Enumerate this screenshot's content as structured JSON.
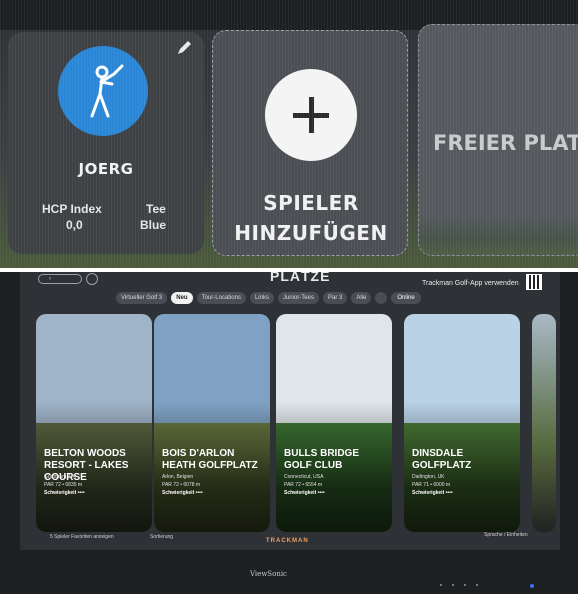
{
  "player_select": {
    "player": {
      "name": "JOERG",
      "hcp_label": "HCP Index",
      "hcp_value": "0,0",
      "tee_label": "Tee",
      "tee_value": "Blue",
      "avatar_icon": "golfer-icon",
      "avatar_color": "#2a86d6"
    },
    "add_player": {
      "line1": "SPIELER",
      "line2": "HINZUFÜGEN"
    },
    "free_slot": {
      "label": "FREIER PLATZ"
    }
  },
  "course_browser": {
    "title": "PLÄTZE",
    "app_hint": "Trackman Golf-App verwenden",
    "filters": [
      "Virtueller Golf 3",
      "Neu",
      "Tour-Locations",
      "Links",
      "Junior-Tees",
      "Par 3",
      "Alle"
    ],
    "active_filter": "Neu",
    "online_label": "Online",
    "courses": [
      {
        "name": "Belton Woods Resort - Lakes Course",
        "location": "Grantham, UK",
        "stats": "PAR 72 • 6835 m",
        "difficulty": "Schwierigkeit ••••",
        "sky": "#9fb4c8",
        "ground": "#5f6b45"
      },
      {
        "name": "Bois d'Arlon Heath Golfplatz",
        "location": "Arlon, Belgien",
        "stats": "PAR 72 • 6078 m",
        "difficulty": "Schwierigkeit ••••",
        "sky": "#7fa2c4",
        "ground": "#6a7a40"
      },
      {
        "name": "Bulls Bridge Golf Club",
        "location": "Connecticut, USA",
        "stats": "PAR 72 • 6554 m",
        "difficulty": "Schwierigkeit ••••",
        "sky": "#dfe6ea",
        "ground": "#3f7a36"
      },
      {
        "name": "Dinsdale Golfplatz",
        "location": "Darlington, UK",
        "stats": "PAR 71 • 6000 m",
        "difficulty": "Schwierigkeit ••••",
        "sky": "#b9d2e6",
        "ground": "#4d7d38"
      }
    ],
    "footer": {
      "left": "5 Spieler Favoriten anzeigen",
      "sort": "Sortierung",
      "logo": "TRACKMAN",
      "right": "Sprache / Einheiten"
    }
  },
  "monitor": {
    "brand": "ViewSonic"
  }
}
